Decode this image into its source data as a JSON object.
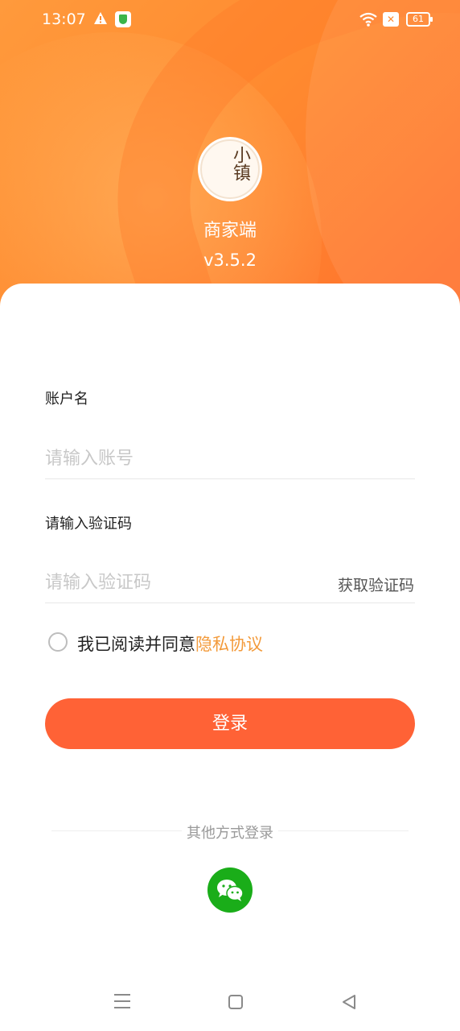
{
  "status_bar": {
    "time": "13:07",
    "battery": "61",
    "icons": [
      "warning-icon",
      "shield-app-icon",
      "wifi-icon",
      "no-sim-icon",
      "battery-icon"
    ]
  },
  "header": {
    "logo_text": "小镇",
    "app_name": "商家端",
    "version": "v3.5.2"
  },
  "form": {
    "account_label": "账户名",
    "account_placeholder": "请输入账号",
    "code_label": "请输入验证码",
    "code_placeholder": "请输入验证码",
    "get_code": "获取验证码",
    "agree_prefix": "我已阅读并同意",
    "privacy_link": "隐私协议",
    "agree_checked": false
  },
  "login_button": "登录",
  "other_login": {
    "title": "其他方式登录",
    "methods": [
      "wechat-icon"
    ]
  },
  "colors": {
    "header_gradient": [
      "#ff9a3c",
      "#ff6f2e"
    ],
    "primary_button": "#ff6236",
    "link": "#f39a3a",
    "wechat": "#1aad19"
  }
}
